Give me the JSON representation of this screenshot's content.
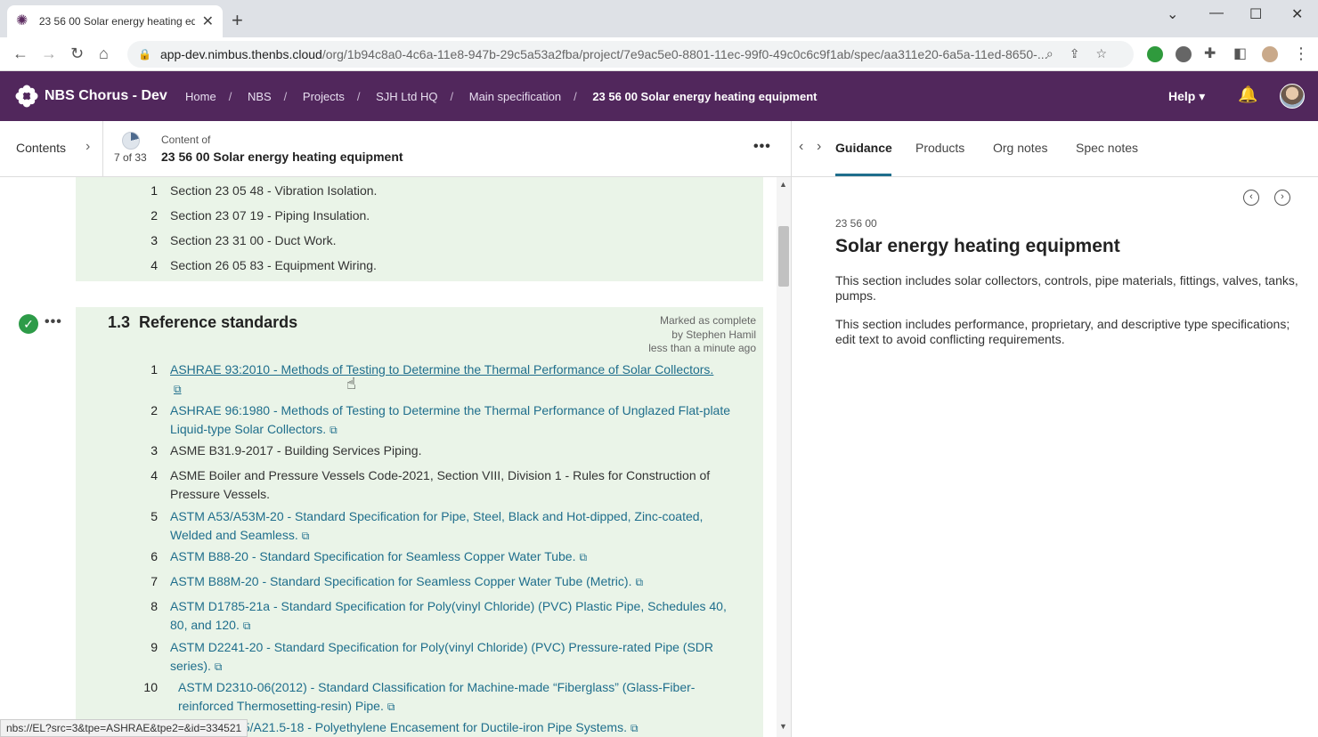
{
  "browser": {
    "tab_title": "23 56 00 Solar energy heating eq",
    "url_host": "app-dev.nimbus.thenbs.cloud",
    "url_path": "/org/1b94c8a0-4c6a-11e8-947b-29c5a53a2fba/project/7e9ac5e0-8801-11ec-99f0-49c0c6c9f1ab/spec/aa311e20-6a5a-11ed-8650-...",
    "status_url": "nbs://EL?src=3&tpe=ASHRAE&tpe2=&id=334521"
  },
  "app": {
    "brand": "NBS Chorus - Dev",
    "breadcrumbs": [
      "Home",
      "NBS",
      "Projects",
      "SJH Ltd HQ",
      "Main specification"
    ],
    "breadcrumb_current": "23 56 00 Solar energy heating equipment",
    "help_label": "Help",
    "accent": "#51275c"
  },
  "subheader": {
    "contents_label": "Contents",
    "progress": "7 of 33",
    "progress_fraction": 0.2121,
    "content_of_label": "Content of",
    "content_title": "23 56 00 Solar energy heating equipment"
  },
  "panel_tabs": [
    "Guidance",
    "Products",
    "Org notes",
    "Spec notes"
  ],
  "related_sections": [
    {
      "num": "1",
      "text": "Section 23 05 48 - Vibration Isolation."
    },
    {
      "num": "2",
      "text": "Section 23 07 19 - Piping Insulation."
    },
    {
      "num": "3",
      "text": "Section 23 31 00 - Duct Work."
    },
    {
      "num": "4",
      "text": "Section 26 05 83 - Equipment Wiring."
    }
  ],
  "reference_standards": {
    "number": "1.3",
    "title": "Reference standards",
    "marked_line1": "Marked as complete",
    "marked_line2": "by Stephen Hamil",
    "marked_line3": "less than a minute ago",
    "items": [
      {
        "num": "1",
        "text": "ASHRAE 93:2010 - Methods of Testing to Determine the Thermal Performance of Solar Collectors."
      },
      {
        "num": "2",
        "text": "ASHRAE 96:1980 - Methods of Testing to Determine the Thermal Performance of Unglazed Flat-plate Liquid-type Solar Collectors."
      },
      {
        "num": "3",
        "text": "ASME B31.9-2017 - Building Services Piping."
      },
      {
        "num": "4",
        "text": "ASME Boiler and Pressure Vessels Code-2021, Section VIII, Division 1 - Rules for Construction of Pressure Vessels."
      },
      {
        "num": "5",
        "text": "ASTM A53/A53M-20 - Standard Specification for Pipe, Steel, Black and Hot-dipped, Zinc-coated, Welded and Seamless."
      },
      {
        "num": "6",
        "text": "ASTM B88-20 - Standard Specification for Seamless Copper Water Tube."
      },
      {
        "num": "7",
        "text": "ASTM B88M-20 - Standard Specification for Seamless Copper Water Tube (Metric)."
      },
      {
        "num": "8",
        "text": "ASTM D1785-21a - Standard Specification for Poly(vinyl Chloride) (PVC) Plastic Pipe, Schedules 40, 80, and 120."
      },
      {
        "num": "9",
        "text": "ASTM D2241-20 - Standard Specification for Poly(vinyl Chloride) (PVC) Pressure-rated Pipe (SDR series)."
      },
      {
        "num": "10",
        "text": "ASTM D2310-06(2012) - Standard Classification for Machine-made “Fiberglass” (Glass-Fiber-reinforced Thermosetting-resin) Pipe."
      },
      {
        "num": "11",
        "text": "AWWA C105/A21.5-18 - Polyethylene Encasement for Ductile-iron Pipe Systems."
      }
    ]
  },
  "guidance": {
    "code": "23 56 00",
    "title": "Solar energy heating equipment",
    "para1": "This section includes solar collectors, controls, pipe materials, fittings, valves, tanks, pumps.",
    "para2": "This section includes performance, proprietary, and descriptive type specifications; edit text to avoid conflicting requirements."
  }
}
